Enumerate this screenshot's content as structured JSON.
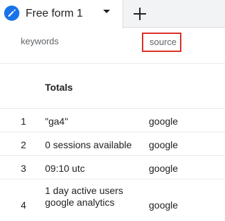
{
  "tabs": {
    "active_label": "Free form 1",
    "icon": "pencil-icon",
    "dropdown_icon": "chevron-down-icon",
    "add_icon": "plus-icon"
  },
  "table": {
    "columns": [
      "keywords",
      "source"
    ],
    "totals_label": "Totals",
    "rows": [
      {
        "index": "1",
        "keyword": "\"ga4\"",
        "source": "google"
      },
      {
        "index": "2",
        "keyword": "0 sessions available",
        "source": "google"
      },
      {
        "index": "3",
        "keyword": "09:10 utc",
        "source": "google"
      },
      {
        "index": "4",
        "keyword": "1 day active users\ngoogle analytics",
        "source": "google"
      }
    ]
  },
  "colors": {
    "accent": "#1a73e8",
    "highlight_border": "#d93025"
  }
}
